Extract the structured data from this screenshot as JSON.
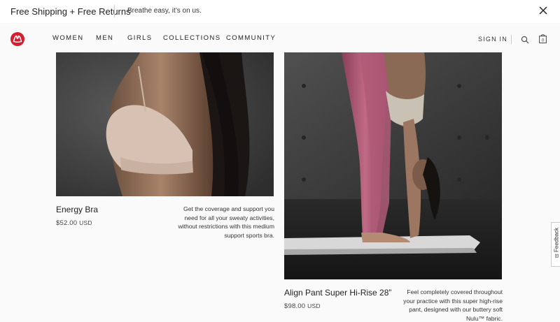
{
  "promo": {
    "title": "Free Shipping + Free Returns",
    "subtitle": "Breathe easy, it’s on us.",
    "close_icon": "close-icon"
  },
  "header": {
    "logo": "lululemon-logo",
    "nav": [
      "WOMEN",
      "MEN",
      "GIRLS",
      "COLLECTIONS",
      "COMMUNITY"
    ],
    "sign_in": "SIGN IN",
    "search_icon": "search-icon",
    "bag_icon": "shopping-bag-icon",
    "bag_count": "0",
    "brand_color": "#d22030"
  },
  "products": [
    {
      "name": "Energy Bra",
      "price": "$52.00",
      "currency": "USD",
      "description": "Get the coverage and support you need for all your sweaty activities, without restrictions with this medium support sports bra."
    },
    {
      "name": "Align Pant Super Hi-Rise 28”",
      "price": "$98.00",
      "currency": "USD",
      "description": "Feel completely covered throughout your practice with this super high-rise pant, designed with our buttery soft Nulu™ fabric."
    }
  ],
  "feedback": {
    "label": "Feedback",
    "icon": "feedback-icon"
  }
}
